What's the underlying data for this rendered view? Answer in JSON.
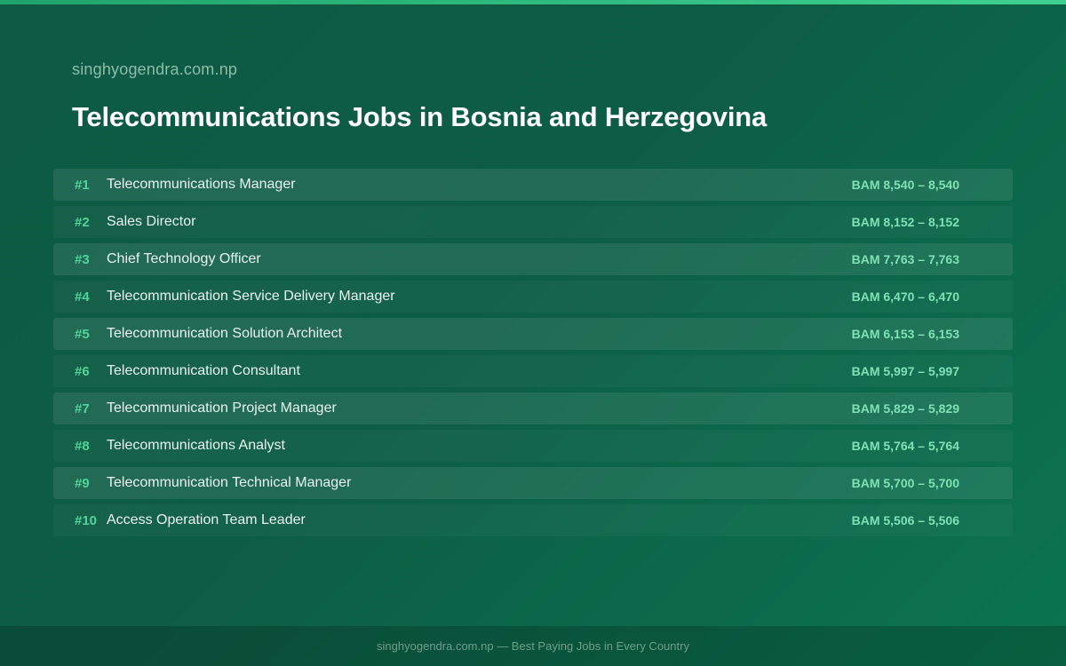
{
  "header": {
    "site_name": "singhyogendra.com.np",
    "title": "Telecommunications Jobs in Bosnia and Herzegovina"
  },
  "jobs": [
    {
      "rank": "#1",
      "title": "Telecommunications Manager",
      "salary": "BAM 8,540 – 8,540"
    },
    {
      "rank": "#2",
      "title": "Sales Director",
      "salary": "BAM 8,152 – 8,152"
    },
    {
      "rank": "#3",
      "title": "Chief Technology Officer",
      "salary": "BAM 7,763 – 7,763"
    },
    {
      "rank": "#4",
      "title": "Telecommunication Service Delivery Manager",
      "salary": "BAM 6,470 – 6,470"
    },
    {
      "rank": "#5",
      "title": "Telecommunication Solution Architect",
      "salary": "BAM 6,153 – 6,153"
    },
    {
      "rank": "#6",
      "title": "Telecommunication Consultant",
      "salary": "BAM 5,997 – 5,997"
    },
    {
      "rank": "#7",
      "title": "Telecommunication Project Manager",
      "salary": "BAM 5,829 – 5,829"
    },
    {
      "rank": "#8",
      "title": "Telecommunications Analyst",
      "salary": "BAM 5,764 – 5,764"
    },
    {
      "rank": "#9",
      "title": "Telecommunication Technical Manager",
      "salary": "BAM 5,700 – 5,700"
    },
    {
      "rank": "#10",
      "title": "Access Operation Team Leader",
      "salary": "BAM 5,506 – 5,506"
    }
  ],
  "footer": {
    "text": "singhyogendra.com.np — Best Paying Jobs in Every Country"
  },
  "colors": {
    "accent": "#4fd49a",
    "salary": "#7fe2b4",
    "background": "#0d5d44"
  }
}
